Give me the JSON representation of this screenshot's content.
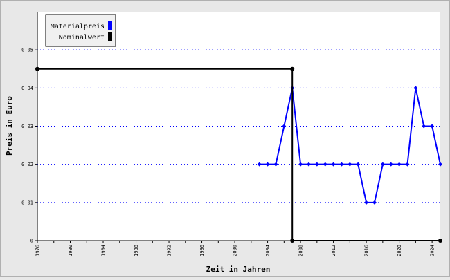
{
  "chart_data": {
    "type": "line",
    "xlabel": "Zeit in Jahren",
    "ylabel": "Preis in Euro",
    "xlim": [
      1976,
      2025
    ],
    "ylim": [
      0,
      0.06
    ],
    "x_tick_labels": [
      "1976",
      "1980",
      "1984",
      "1988",
      "1992",
      "1996",
      "2000",
      "2004",
      "2008",
      "2012",
      "2016",
      "2020",
      "2024"
    ],
    "y_tick_labels": [
      "0",
      "0.01",
      "0.02",
      "0.03",
      "0.04",
      "0.05"
    ],
    "grid": "horizontal dotted",
    "legend_position": "top-left",
    "series": [
      {
        "name": "Materialpreis",
        "color": "#0000ff",
        "x": [
          2003,
          2004,
          2005,
          2006,
          2007,
          2008,
          2009,
          2010,
          2011,
          2012,
          2013,
          2014,
          2015,
          2016,
          2017,
          2018,
          2019,
          2020,
          2021,
          2022,
          2023,
          2024,
          2025
        ],
        "y": [
          0.02,
          0.02,
          0.02,
          0.03,
          0.04,
          0.02,
          0.02,
          0.02,
          0.02,
          0.02,
          0.02,
          0.02,
          0.02,
          0.01,
          0.01,
          0.02,
          0.02,
          0.02,
          0.02,
          0.04,
          0.03,
          0.03,
          0.02
        ]
      },
      {
        "name": "Nominalwert",
        "color": "#000000",
        "x": [
          1976,
          2007,
          2007,
          2025
        ],
        "y": [
          0.045,
          0.045,
          0,
          0
        ]
      }
    ]
  }
}
